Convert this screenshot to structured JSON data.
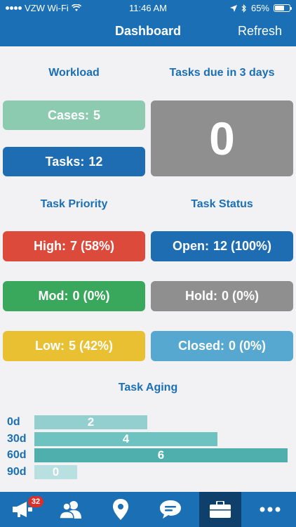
{
  "status_bar": {
    "carrier": "VZW Wi-Fi",
    "time": "11:46 AM",
    "battery": "65%",
    "battery_level": 0.65
  },
  "nav": {
    "title": "Dashboard",
    "refresh_label": "Refresh"
  },
  "workload": {
    "title": "Workload",
    "cases_label": "Cases:",
    "cases_value": "5",
    "tasks_label": "Tasks:",
    "tasks_value": "12"
  },
  "due": {
    "title": "Tasks due in 3 days",
    "value": "0"
  },
  "priority": {
    "title": "Task Priority",
    "items": [
      {
        "label": "High:",
        "value": "7 (58%)"
      },
      {
        "label": "Mod:",
        "value": "0 (0%)"
      },
      {
        "label": "Low:",
        "value": "5 (42%)"
      }
    ]
  },
  "status": {
    "title": "Task Status",
    "items": [
      {
        "label": "Open:",
        "value": "12 (100%)"
      },
      {
        "label": "Hold:",
        "value": "0 (0%)"
      },
      {
        "label": "Closed:",
        "value": "0 (0%)"
      }
    ]
  },
  "aging": {
    "title": "Task Aging",
    "rows": [
      {
        "label": "0d",
        "value": "2"
      },
      {
        "label": "30d",
        "value": "4"
      },
      {
        "label": "60d",
        "value": "6"
      },
      {
        "label": "90d",
        "value": "0"
      }
    ]
  },
  "tabs": {
    "badge": "32",
    "items": [
      "megaphone-icon",
      "contacts-icon",
      "location-pin-icon",
      "chat-icon",
      "briefcase-icon",
      "more-icon"
    ]
  },
  "colors": {
    "primary": "#1a6fb5",
    "cases": "#8ccbb0",
    "tasks": "#1e6db3",
    "high": "#db4a3b",
    "mod": "#3aa85c",
    "low": "#e8c032",
    "open": "#1e6db3",
    "hold": "#8f8f8f",
    "closed": "#56a8d0"
  }
}
